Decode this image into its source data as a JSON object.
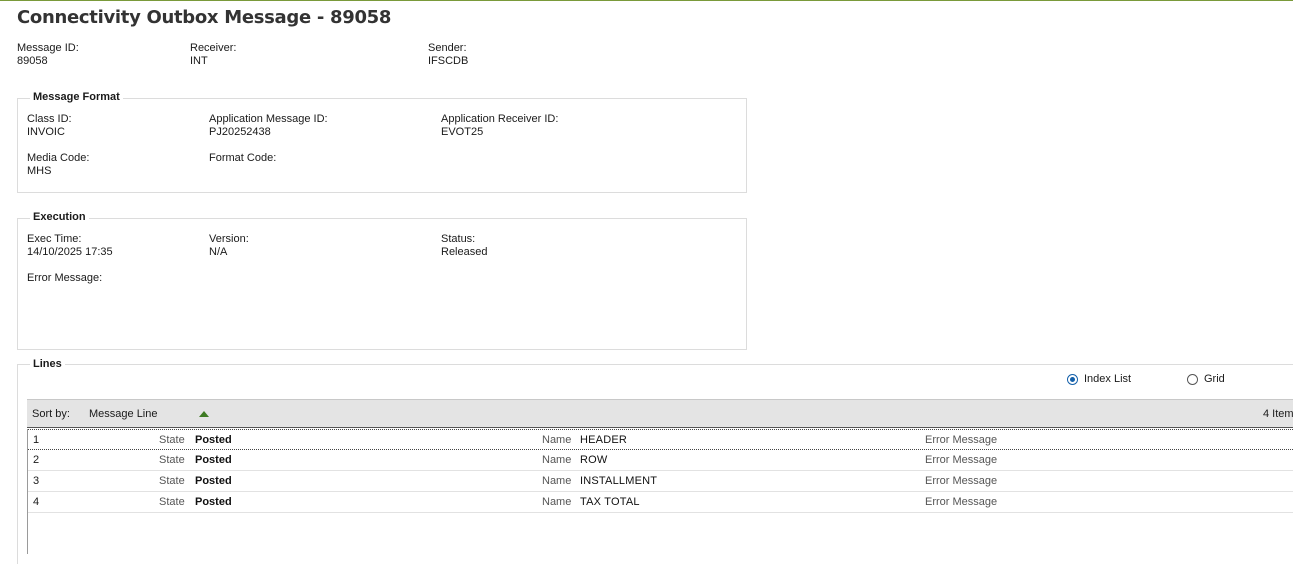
{
  "page": {
    "title": "Connectivity Outbox Message - 89058"
  },
  "header": {
    "message_id": {
      "label": "Message ID:",
      "value": "89058"
    },
    "receiver": {
      "label": "Receiver:",
      "value": "INT"
    },
    "sender": {
      "label": "Sender:",
      "value": "IFSCDB"
    }
  },
  "message_format": {
    "title": "Message Format",
    "class_id": {
      "label": "Class ID:",
      "value": "INVOIC"
    },
    "app_message_id": {
      "label": "Application Message ID:",
      "value": "PJ20252438"
    },
    "app_receiver_id": {
      "label": "Application Receiver ID:",
      "value": "EVOT25"
    },
    "media_code": {
      "label": "Media Code:",
      "value": "MHS"
    },
    "format_code": {
      "label": "Format Code:",
      "value": ""
    }
  },
  "execution": {
    "title": "Execution",
    "exec_time": {
      "label": "Exec Time:",
      "value": "14/10/2025 17:35"
    },
    "version": {
      "label": "Version:",
      "value": "N/A"
    },
    "status": {
      "label": "Status:",
      "value": "Released"
    },
    "error_message": {
      "label": "Error Message:",
      "value": ""
    }
  },
  "lines": {
    "title": "Lines",
    "view_options": {
      "index_list": "Index List",
      "grid": "Grid",
      "selected": "index_list"
    },
    "sort_by_label": "Sort by:",
    "sort_field": "Message Line",
    "item_count": "4 Item",
    "rows": [
      {
        "index": "1",
        "state_label": "State",
        "state": "Posted",
        "name_label": "Name",
        "name": "HEADER",
        "error_label": "Error Message"
      },
      {
        "index": "2",
        "state_label": "State",
        "state": "Posted",
        "name_label": "Name",
        "name": "ROW",
        "error_label": "Error Message"
      },
      {
        "index": "3",
        "state_label": "State",
        "state": "Posted",
        "name_label": "Name",
        "name": "INSTALLMENT",
        "error_label": "Error Message"
      },
      {
        "index": "4",
        "state_label": "State",
        "state": "Posted",
        "name_label": "Name",
        "name": "TAX TOTAL",
        "error_label": "Error Message"
      }
    ]
  },
  "colors": {
    "accent": "#1460aa",
    "sort_arrow": "#3d7a22",
    "top_border": "#7a9a3a"
  }
}
